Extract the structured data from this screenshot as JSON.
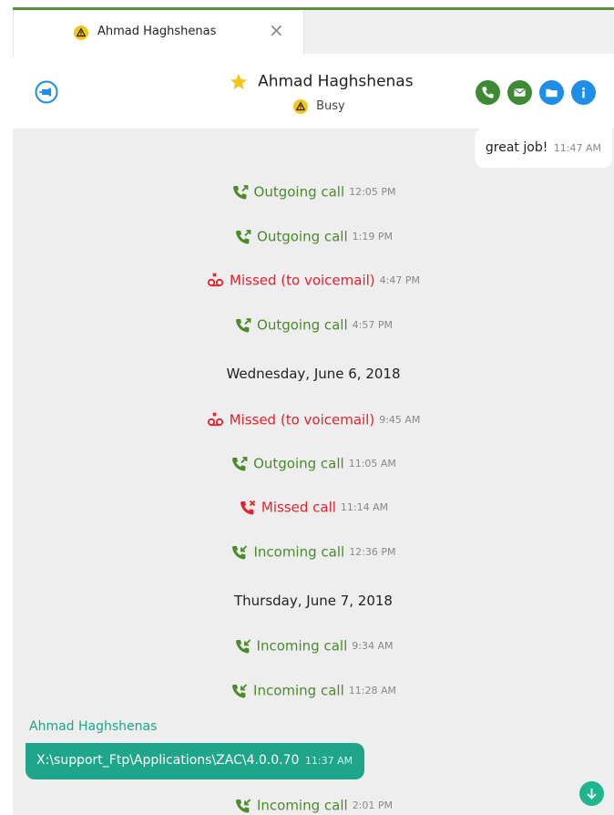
{
  "colors": {
    "accent_green": "#5a8f3a",
    "call_green": "#4a8b2b",
    "missed_red": "#e8202a",
    "teal": "#1ea58a",
    "blue_action": "#1f8ee6",
    "busy_yellow": "#f5c518"
  },
  "tab": {
    "label": "Ahmad Haghshenas",
    "status_icon": "busy-warning-icon",
    "close_glyph": "×"
  },
  "header": {
    "name": "Ahmad Haghshenas",
    "favorite_icon": "star-icon",
    "status": "Busy",
    "actions": [
      {
        "name": "call-button",
        "icon": "phone-icon",
        "color": "#3e8a34"
      },
      {
        "name": "email-button",
        "icon": "envelope-icon",
        "color": "#3e8a34"
      },
      {
        "name": "files-button",
        "icon": "folder-icon",
        "color": "#1f8ee6"
      },
      {
        "name": "info-button",
        "icon": "info-icon",
        "color": "#1f8ee6"
      }
    ]
  },
  "messages": {
    "outgoing": {
      "text": "great job!",
      "time": "11:47 AM"
    },
    "incoming": {
      "sender": "Ahmad Haghshenas",
      "text": "X:\\support_Ftp\\Applications\\ZAC\\4.0.0.70",
      "time": "11:37 AM"
    }
  },
  "events": [
    {
      "type": "outgoing",
      "label": "Outgoing call",
      "time": "12:05 PM"
    },
    {
      "type": "outgoing",
      "label": "Outgoing call",
      "time": "1:19 PM"
    },
    {
      "type": "voicemail",
      "label": "Missed (to voicemail)",
      "time": "4:47 PM"
    },
    {
      "type": "outgoing",
      "label": "Outgoing call",
      "time": "4:57 PM"
    },
    {
      "type": "voicemail",
      "label": "Missed (to voicemail)",
      "time": "9:45 AM"
    },
    {
      "type": "outgoing",
      "label": "Outgoing call",
      "time": "11:05 AM"
    },
    {
      "type": "missed",
      "label": "Missed call",
      "time": "11:14 AM"
    },
    {
      "type": "incoming",
      "label": "Incoming call",
      "time": "12:36 PM"
    },
    {
      "type": "incoming",
      "label": "Incoming call",
      "time": "9:34 AM"
    },
    {
      "type": "incoming",
      "label": "Incoming call",
      "time": "11:28 AM"
    },
    {
      "type": "incoming",
      "label": "Incoming call",
      "time": "2:01 PM"
    }
  ],
  "dates": [
    "Wednesday, June 6, 2018",
    "Thursday, June 7, 2018"
  ],
  "scroll_icon": "arrow-down-icon"
}
